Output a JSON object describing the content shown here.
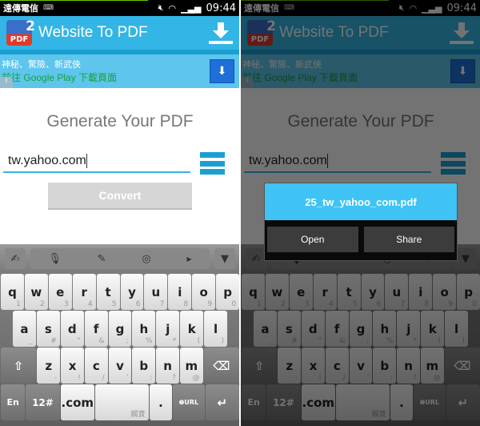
{
  "status": {
    "carrier": "遠傳電信",
    "time": "09:44"
  },
  "appbar": {
    "logo_text": "PDF",
    "logo_badge": "2",
    "title": "Website To PDF"
  },
  "ad": {
    "line1": "神秘、驚險、新武俠",
    "line2": "前往 Google Play 下載頁面"
  },
  "main": {
    "title": "Generate Your PDF",
    "url_value": "tw.yahoo.com",
    "convert_label": "Convert"
  },
  "keyboard": {
    "row1": [
      [
        "q",
        "1"
      ],
      [
        "w",
        "2"
      ],
      [
        "e",
        "3"
      ],
      [
        "r",
        "4"
      ],
      [
        "t",
        "5"
      ],
      [
        "y",
        "6"
      ],
      [
        "u",
        "7"
      ],
      [
        "i",
        "8"
      ],
      [
        "o",
        "9"
      ],
      [
        "p",
        "0"
      ]
    ],
    "row2": [
      [
        "a",
        "_"
      ],
      [
        "s",
        "#"
      ],
      [
        "d",
        "\""
      ],
      [
        "f",
        "&"
      ],
      [
        "g",
        ";"
      ],
      [
        "h",
        "%"
      ],
      [
        "j",
        "*"
      ],
      [
        "k",
        "("
      ],
      [
        "l",
        ")"
      ]
    ],
    "row3": [
      [
        "z",
        "-"
      ],
      [
        "x",
        "!"
      ],
      [
        "c",
        "/"
      ],
      [
        "v",
        "'"
      ],
      [
        "b",
        ":"
      ],
      [
        "n",
        "?"
      ],
      [
        "m",
        "@"
      ]
    ],
    "lang": "En",
    "symbols": "12#",
    "dotcom": ".com",
    "space_label": "觸寶",
    "period": ".",
    "url_label": "URL"
  },
  "dialog": {
    "filename": "25_tw_yahoo_com.pdf",
    "open_label": "Open",
    "share_label": "Share"
  },
  "colors": {
    "accent": "#33b5e5",
    "ad_button": "#1f6fd8",
    "dialog_title": "#3ec3f4"
  }
}
